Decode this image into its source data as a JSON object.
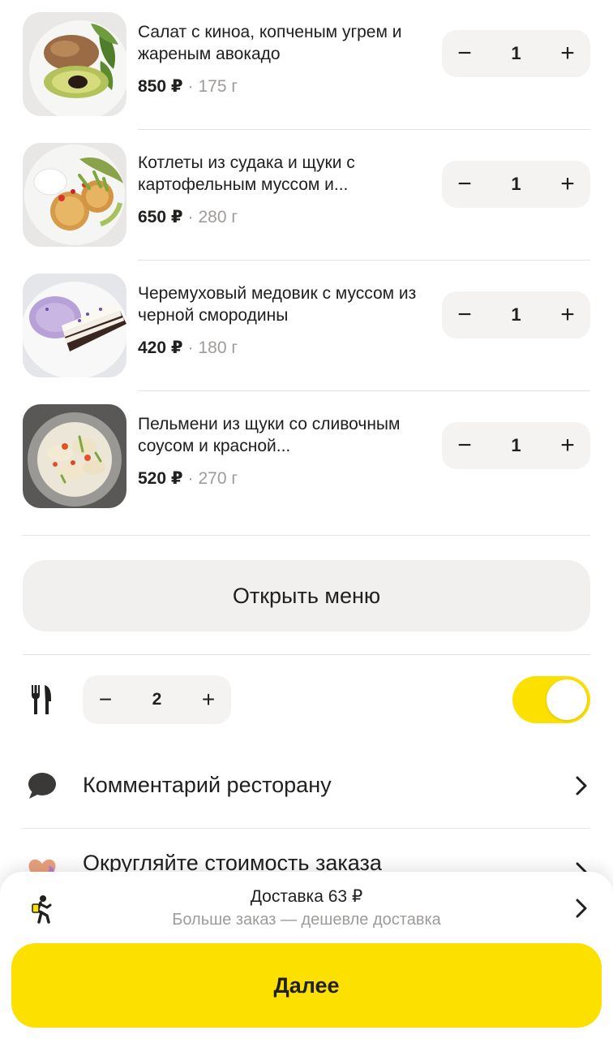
{
  "items": [
    {
      "name": "Салат с киноа, копченым угрем и жареным авокадо",
      "price": "850 ₽",
      "weight": "175 г",
      "qty": "1",
      "image": "quinoa-salad-photo"
    },
    {
      "name": "Котлеты из судака и щуки с картофельным муссом и...",
      "price": "650 ₽",
      "weight": "280 г",
      "qty": "1",
      "image": "fish-cutlets-photo"
    },
    {
      "name": "Черемуховый медовик с муссом из черной смородины",
      "price": "420 ₽",
      "weight": "180 г",
      "qty": "1",
      "image": "honey-cake-photo"
    },
    {
      "name": "Пельмени из щуки со сливочным соусом и красной...",
      "price": "520 ₽",
      "weight": "270 г",
      "qty": "1",
      "image": "pike-dumplings-photo"
    }
  ],
  "stepper": {
    "minus": "−",
    "plus": "+",
    "dot": "·"
  },
  "open_menu_label": "Открыть меню",
  "cutlery": {
    "icon": "cutlery-icon",
    "qty": "2",
    "toggle_on": true
  },
  "comment_label": "Комментарий ресторану",
  "round_label": "Округляйте стоимость заказа",
  "delivery": {
    "title": "Доставка 63 ₽",
    "subtitle": "Больше заказ — дешевле доставка",
    "icon": "runner-icon"
  },
  "next_label": "Далее",
  "colors": {
    "accent": "#fce000",
    "text": "#21201f",
    "muted": "#9e9b98",
    "surface": "#f4f3f1"
  }
}
